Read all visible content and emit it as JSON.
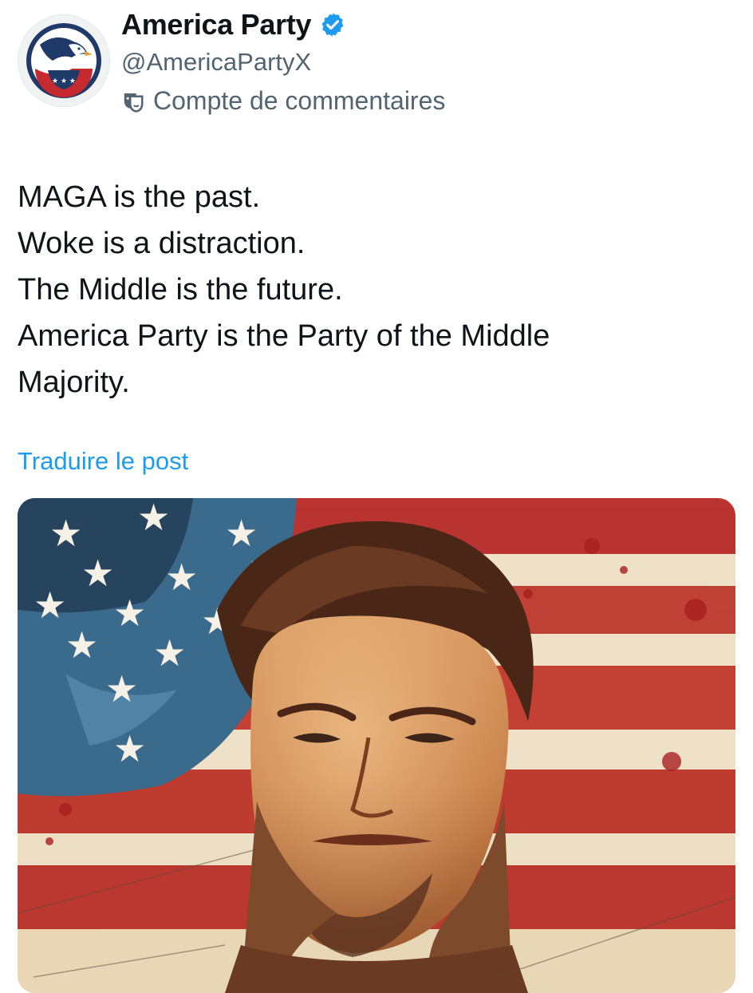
{
  "post": {
    "author": {
      "display_name": "America Party",
      "handle": "@AmericaPartyX",
      "verified": true,
      "verified_icon": "verified-badge-icon",
      "affiliation_label": "Compte de commentaires",
      "affiliation_icon": "theater-masks-icon",
      "avatar_icon": "eagle-logo"
    },
    "text_lines": [
      "MAGA is the past.",
      "Woke is a distraction.",
      "The Middle is the future.",
      "America Party is the Party of the Middle",
      "Majority."
    ],
    "translate_label": "Traduire le post",
    "media": {
      "type": "image",
      "subject": "painted portrait over american flag"
    }
  },
  "colors": {
    "link": "#1d9bf0",
    "secondary_text": "#536471",
    "primary_text": "#0f1419",
    "verified": "#1d9bf0"
  }
}
